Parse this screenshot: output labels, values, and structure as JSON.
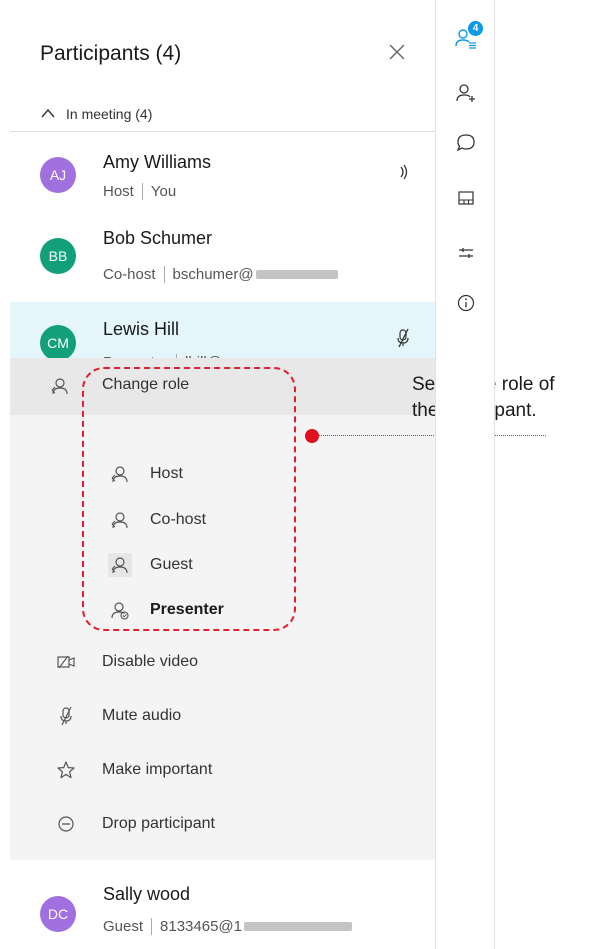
{
  "header": {
    "title": "Participants (4)"
  },
  "section": {
    "label": "In meeting (4)"
  },
  "participants": [
    {
      "initials": "AJ",
      "name": "Amy Williams",
      "role": "Host",
      "extra": "You",
      "color": "#a070e0"
    },
    {
      "initials": "BB",
      "name": "Bob Schumer",
      "role": "Co-host",
      "extra": "bschumer@",
      "color": "#12a07a"
    },
    {
      "initials": "CM",
      "name": "Lewis Hill",
      "role": "Presenter",
      "extra": "lhill@",
      "extra_tail": "...",
      "color": "#12a07a",
      "highlight": "#e4f6fc"
    },
    {
      "initials": "DC",
      "name": "Sally wood",
      "role": "Guest",
      "extra": "8133465@1",
      "color": "#a070e0"
    }
  ],
  "menu": {
    "change_role": "Change role",
    "roles": [
      "Host",
      "Co-host",
      "Guest",
      "Presenter"
    ],
    "selected_role": "Presenter",
    "actions": [
      "Disable video",
      "Mute audio",
      "Make important",
      "Drop participant"
    ]
  },
  "annotation": {
    "line1": "Select the role of",
    "line2": "the participant."
  },
  "rail": {
    "participants_badge": "4"
  },
  "colors": {
    "accent": "#0a9be8",
    "callout": "#e0202e"
  }
}
